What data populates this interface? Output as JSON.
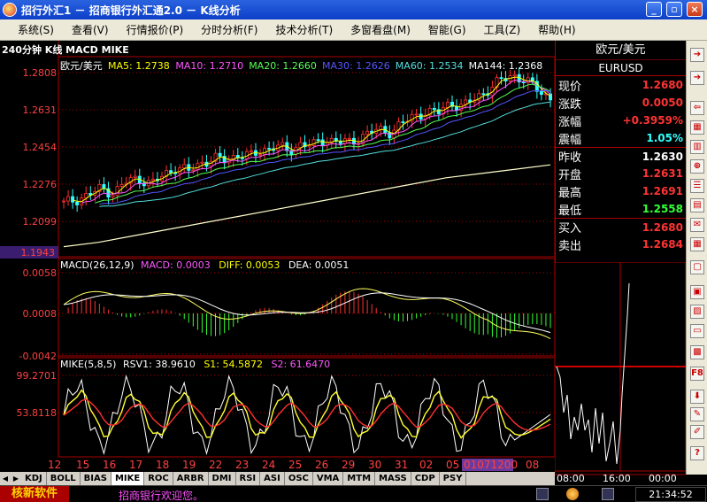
{
  "window": {
    "title": "招行外汇1 － 招商银行外汇通2.0 － K线分析"
  },
  "menu": [
    "系统(S)",
    "查看(V)",
    "行情报价(P)",
    "分时分析(F)",
    "技术分析(T)",
    "多窗看盘(M)",
    "智能(G)",
    "工具(Z)",
    "帮助(H)"
  ],
  "chart": {
    "period_label": "240分钟 K线 MACD MIKE",
    "pair_label": "欧元/美元",
    "ma": [
      {
        "name": "MA5",
        "value": "1.2738",
        "color": "#ffff00"
      },
      {
        "name": "MA10",
        "value": "1.2710",
        "color": "#ff55ff"
      },
      {
        "name": "MA20",
        "value": "1.2660",
        "color": "#55ff55"
      },
      {
        "name": "MA30",
        "value": "1.2626",
        "color": "#5555ff"
      },
      {
        "name": "MA60",
        "value": "1.2534",
        "color": "#55dddd"
      },
      {
        "name": "MA144",
        "value": "1.2368",
        "color": "#ffffff"
      }
    ],
    "price_ticks": [
      "1.2808",
      "1.2631",
      "1.2454",
      "1.2276",
      "1.2099"
    ],
    "price_low_label": "1.1943",
    "macd_header": {
      "name": "MACD(26,12,9)",
      "macd": "MACD: 0.0003",
      "diff": "DIFF: 0.0053",
      "dea": "DEA: 0.0051"
    },
    "macd_ticks": [
      "0.0058",
      "0.0008",
      "-0.0042"
    ],
    "mike_header": {
      "name": "MIKE(5,8,5)",
      "rsv": "RSV1: 38.9610",
      "s1": "S1: 54.5872",
      "s2": "S2: 61.6470"
    },
    "mike_ticks": [
      "99.2701",
      "53.8118"
    ],
    "date_ticks": [
      "12",
      "15",
      "16",
      "17",
      "18",
      "19",
      "22",
      "23",
      "24",
      "25",
      "26",
      "29",
      "30",
      "31",
      "02",
      "05",
      "01071200",
      "08"
    ]
  },
  "chart_data": {
    "type": "line",
    "candles_close": [
      1.219,
      1.221,
      1.223,
      1.226,
      1.224,
      1.229,
      1.231,
      1.228,
      1.232,
      1.236,
      1.234,
      1.238,
      1.24,
      1.239,
      1.242,
      1.241,
      1.244,
      1.246,
      1.243,
      1.247,
      1.246,
      1.249,
      1.248,
      1.247,
      1.251,
      1.253,
      1.252,
      1.256,
      1.259,
      1.262,
      1.261,
      1.266,
      1.264,
      1.268,
      1.272,
      1.276,
      1.279,
      1.276,
      1.272,
      1.268
    ],
    "ma144": [
      1.199,
      1.201,
      1.204,
      1.207,
      1.21,
      1.213,
      1.216,
      1.219,
      1.222,
      1.225,
      1.228,
      1.231,
      1.233,
      1.235,
      1.237
    ],
    "ylim": [
      1.1943,
      1.2808
    ]
  },
  "quote": {
    "title": "欧元/美元",
    "code": "EURUSD",
    "rows": [
      {
        "label": "现价",
        "value": "1.2680",
        "color": "#ff3333"
      },
      {
        "label": "涨跌",
        "value": "0.0050",
        "color": "#ff3333"
      },
      {
        "label": "涨幅",
        "value": "+0.3959%",
        "color": "#ff3333"
      },
      {
        "label": "震幅",
        "value": "1.05%",
        "color": "#33ffff"
      },
      {
        "label": "昨收",
        "value": "1.2630",
        "color": "#ffffff"
      },
      {
        "label": "开盘",
        "value": "1.2631",
        "color": "#ff3333"
      },
      {
        "label": "最高",
        "value": "1.2691",
        "color": "#ff3333"
      },
      {
        "label": "最低",
        "value": "1.2558",
        "color": "#33ff33"
      },
      {
        "label": "买入",
        "value": "1.2680",
        "color": "#ff3333"
      },
      {
        "label": "卖出",
        "value": "1.2684",
        "color": "#ff3333"
      }
    ],
    "mini_times": [
      "08:00",
      "16:00",
      "00:00"
    ]
  },
  "tabs": [
    "KDJ",
    "BOLL",
    "BIAS",
    "MIKE",
    "ROC",
    "ARBR",
    "DMI",
    "RSI",
    "ASI",
    "OSC",
    "VMA",
    "MTM",
    "MASS",
    "CDP",
    "PSY"
  ],
  "active_tab": "MIKE",
  "status": {
    "brand": "核新软件",
    "scroll_text": "招商银行欢迎您。",
    "clock": "21:34:52"
  },
  "toolbar_icons": [
    "arrow-right-icon",
    "arrow-right-icon",
    "arrow-left-icon",
    "chart-icon",
    "bars-icon",
    "zoom-icon",
    "list-icon",
    "table-icon",
    "news-icon",
    "grid-icon",
    "window-icon",
    "layout-icon",
    "compare-icon",
    "screen-icon",
    "stats-icon",
    "f8-key-icon",
    "download-icon",
    "edit-icon",
    "pen-icon",
    "help-icon"
  ]
}
